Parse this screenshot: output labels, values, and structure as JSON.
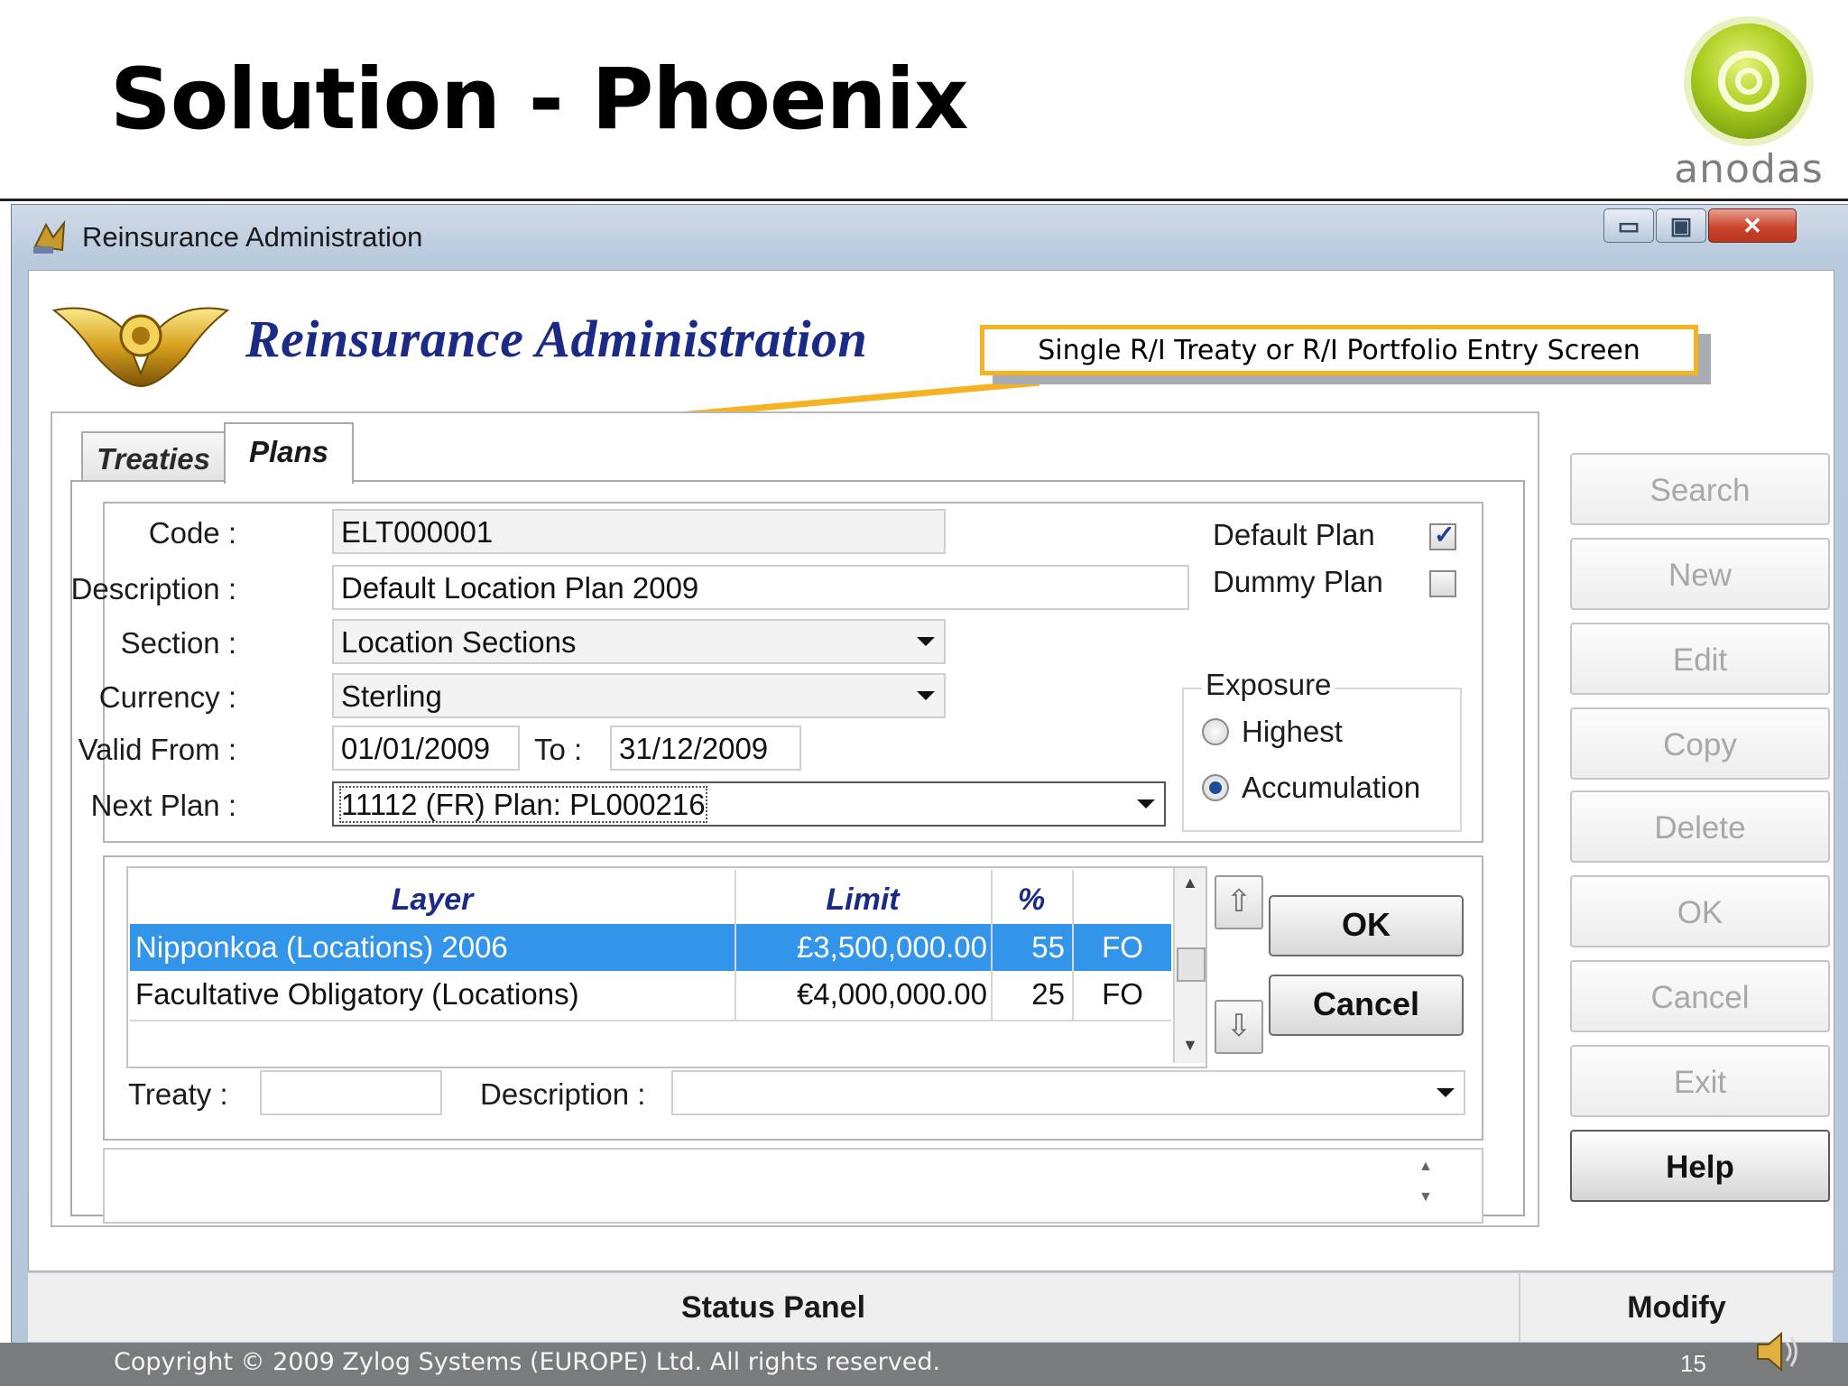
{
  "slide": {
    "title": "Solution - Phoenix",
    "brand": "anodas",
    "copyright": "Copyright © 2009 Zylog Systems (EUROPE) Ltd. All rights reserved.",
    "page_number": "15"
  },
  "window": {
    "title": "Reinsurance Administration",
    "app_title": "Reinsurance Administration",
    "callout": "Single R/I Treaty or R/I Portfolio Entry Screen"
  },
  "tabs": [
    {
      "label": "Treaties",
      "active": false
    },
    {
      "label": "Plans",
      "active": true
    }
  ],
  "form": {
    "code_label": "Code :",
    "code_value": "ELT000001",
    "description_label": "Description :",
    "description_value": "Default Location Plan 2009",
    "section_label": "Section :",
    "section_value": "Location Sections",
    "currency_label": "Currency :",
    "currency_value": "Sterling",
    "valid_from_label": "Valid From :",
    "valid_from_value": "01/01/2009",
    "to_label": "To :",
    "to_value": "31/12/2009",
    "next_plan_label": "Next Plan :",
    "next_plan_value": "11112 (FR) Plan: PL000216",
    "default_plan_label": "Default Plan",
    "default_plan_checked": true,
    "dummy_plan_label": "Dummy Plan",
    "dummy_plan_checked": false,
    "exposure_label": "Exposure",
    "exposure_options": [
      "Highest",
      "Accumulation"
    ],
    "exposure_selected": "Accumulation"
  },
  "grid": {
    "headers": {
      "layer": "Layer",
      "limit": "Limit",
      "percent": "%"
    },
    "rows": [
      {
        "layer": "Nipponkoa (Locations) 2006",
        "limit": "£3,500,000.00",
        "percent": "55",
        "type": "FO",
        "selected": true
      },
      {
        "layer": "Facultative Obligatory (Locations)",
        "limit": "€4,000,000.00",
        "percent": "25",
        "type": "FO",
        "selected": false
      }
    ],
    "ok_label": "OK",
    "cancel_label": "Cancel",
    "treaty_label": "Treaty :",
    "treaty_value": "",
    "grid_description_label": "Description :",
    "grid_description_value": ""
  },
  "side_buttons": [
    "Search",
    "New",
    "Edit",
    "Copy",
    "Delete",
    "OK",
    "Cancel",
    "Exit",
    "Help"
  ],
  "status": {
    "panel": "Status Panel",
    "mode": "Modify"
  },
  "colors": {
    "accent_yellow": "#f5b324",
    "title_navy": "#1a2a86",
    "selection_blue": "#3395e9",
    "brand_green": "#9dc41a"
  }
}
